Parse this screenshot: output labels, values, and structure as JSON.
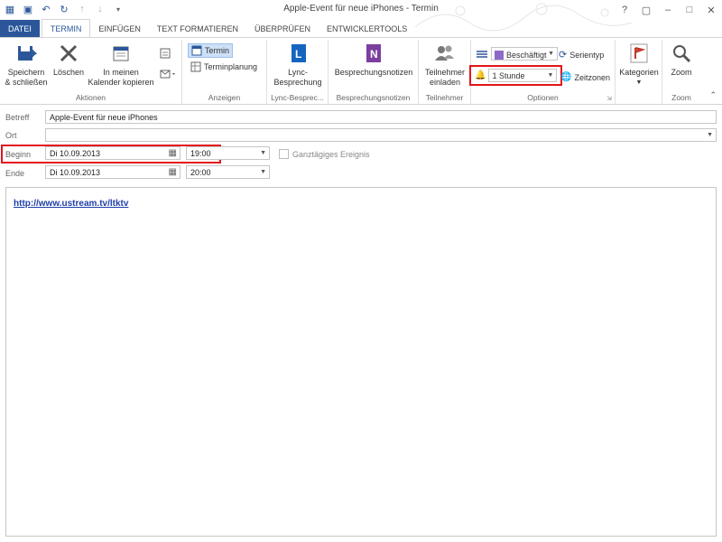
{
  "window": {
    "title": "Apple-Event für neue iPhones - Termin",
    "controls": {
      "help": "?",
      "restore": "▢",
      "minimize": "–",
      "maximize": "□",
      "close": "✕"
    }
  },
  "tabs": [
    "DATEI",
    "TERMIN",
    "EINFÜGEN",
    "TEXT FORMATIEREN",
    "ÜBERPRÜFEN",
    "ENTWICKLERTOOLS"
  ],
  "ribbon": {
    "aktionen": {
      "save": "Speichern\n& schließen",
      "delete": "Löschen",
      "copy": "In meinen\nKalender kopieren",
      "label": "Aktionen"
    },
    "anzeigen": {
      "termin": "Termin",
      "planung": "Terminplanung",
      "label": "Anzeigen"
    },
    "lync": {
      "btn": "Lync-\nBesprechung",
      "label": "Lync-Besprec..."
    },
    "notes": {
      "btn": "Besprechungsnotizen",
      "label": "Besprechungsnotizen"
    },
    "teilnehmer": {
      "btn": "Teilnehmer\neinladen",
      "label": "Teilnehmer"
    },
    "optionen": {
      "status": "Beschäftigt",
      "reminder": "1 Stunde",
      "serientyp": "Serientyp",
      "zeitzonen": "Zeitzonen",
      "label": "Optionen"
    },
    "kategorien": {
      "btn": "Kategorien",
      "label": ""
    },
    "zoom": {
      "btn": "Zoom",
      "label": "Zoom"
    }
  },
  "form": {
    "betreff_label": "Betreff",
    "betreff_value": "Apple-Event für neue iPhones",
    "ort_label": "Ort",
    "ort_value": "",
    "beginn_label": "Beginn",
    "beginn_date": "Di 10.09.2013",
    "beginn_time": "19:00",
    "allday_label": "Ganztägiges Ereignis",
    "ende_label": "Ende",
    "ende_date": "Di 10.09.2013",
    "ende_time": "20:00"
  },
  "body": {
    "link": "http://www.ustream.tv/ltktv"
  },
  "colors": {
    "accent": "#2b579a",
    "highlight": "#e3151b",
    "status_purple": "#8e6ac8"
  }
}
